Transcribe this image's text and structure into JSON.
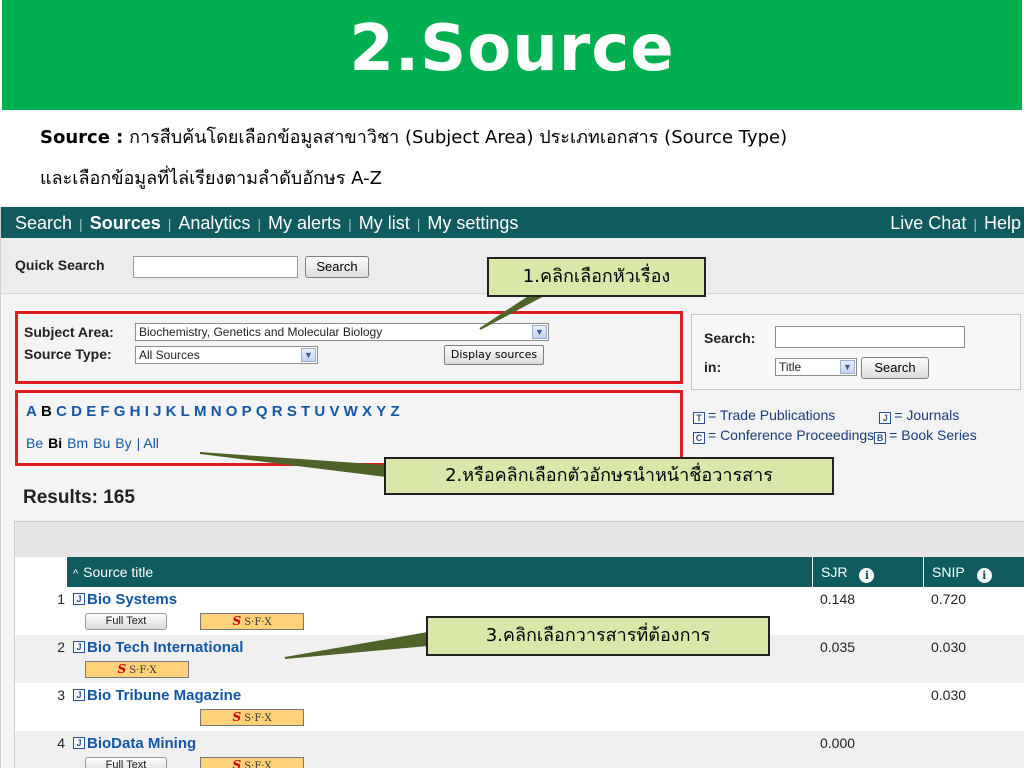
{
  "slide": {
    "title": "2.Source",
    "desc_label": "Source :",
    "desc_line1_rest": " การสืบค้นโดยเลือกข้อมูลสาขาวิชา (Subject Area) ประเภทเอกสาร (Source Type)",
    "desc_line2": "และเลือกข้อมูลที่ไล่เรียงตามลำดับอักษร A-Z"
  },
  "nav": {
    "items": [
      "Search",
      "Sources",
      "Analytics",
      "My alerts",
      "My list",
      "My settings"
    ],
    "active": "Sources",
    "right_items": [
      "Live Chat",
      "Help"
    ]
  },
  "quick_search": {
    "label": "Quick Search",
    "value": "",
    "button": "Search"
  },
  "filters": {
    "subject_label": "Subject Area:",
    "subject_value": "Biochemistry, Genetics and Molecular Biology",
    "type_label": "Source Type:",
    "type_value": "All Sources",
    "display_button": "Display sources"
  },
  "search_panel": {
    "search_label": "Search:",
    "search_value": "",
    "in_label": "in:",
    "in_value": "Title",
    "button": "Search"
  },
  "alphabet": {
    "letters": [
      "A",
      "B",
      "C",
      "D",
      "E",
      "F",
      "G",
      "H",
      "I",
      "J",
      "K",
      "L",
      "M",
      "N",
      "O",
      "P",
      "Q",
      "R",
      "S",
      "T",
      "U",
      "V",
      "W",
      "X",
      "Y",
      "Z"
    ],
    "current": "B",
    "sub": [
      "Be",
      "Bi",
      "Bm",
      "Bu",
      "By"
    ],
    "sub_current": "Bi",
    "all_label": "All"
  },
  "legend": {
    "trade": "= Trade Publications",
    "journals": "= Journals",
    "conference": "= Conference Proceedings",
    "book": "= Book Series",
    "trade_icon_letter": "T",
    "journal_icon_letter": "J",
    "conference_icon_letter": "C",
    "book_icon_letter": "B"
  },
  "results": {
    "label": "Results: 165"
  },
  "table": {
    "col_title": "Source title",
    "sort_glyph": "^",
    "col_sjr": "SJR",
    "col_snip": "SNIP",
    "info_glyph": "i",
    "journal_icon_letter": "J",
    "full_text_label": "Full Text",
    "sfx_brand": "S·F·X",
    "sfx_glyph": "S",
    "rows": [
      {
        "num": "1",
        "title": "Bio Systems",
        "sjr": "0.148",
        "snip": "0.720"
      },
      {
        "num": "2",
        "title": "Bio Tech International",
        "sjr": "0.035",
        "snip": "0.030"
      },
      {
        "num": "3",
        "title": "Bio Tribune Magazine",
        "sjr": "",
        "snip": "0.030"
      },
      {
        "num": "4",
        "title": "BioData Mining",
        "sjr": "0.000",
        "snip": ""
      }
    ]
  },
  "callouts": {
    "c1": "1.คลิกเลือกหัวเรื่อง",
    "c2": "2.หรือคลิกเลือกตัวอักษรนำหน้าชื่อวารสาร",
    "c3": "3.คลิกเลือกวารสารที่ต้องการ"
  },
  "colors": {
    "title_bg": "#00b050",
    "nav_bg": "#0f5b60",
    "highlight_border": "#e11b22",
    "callout_bg": "#d9e8a9",
    "link": "#1256a4"
  }
}
